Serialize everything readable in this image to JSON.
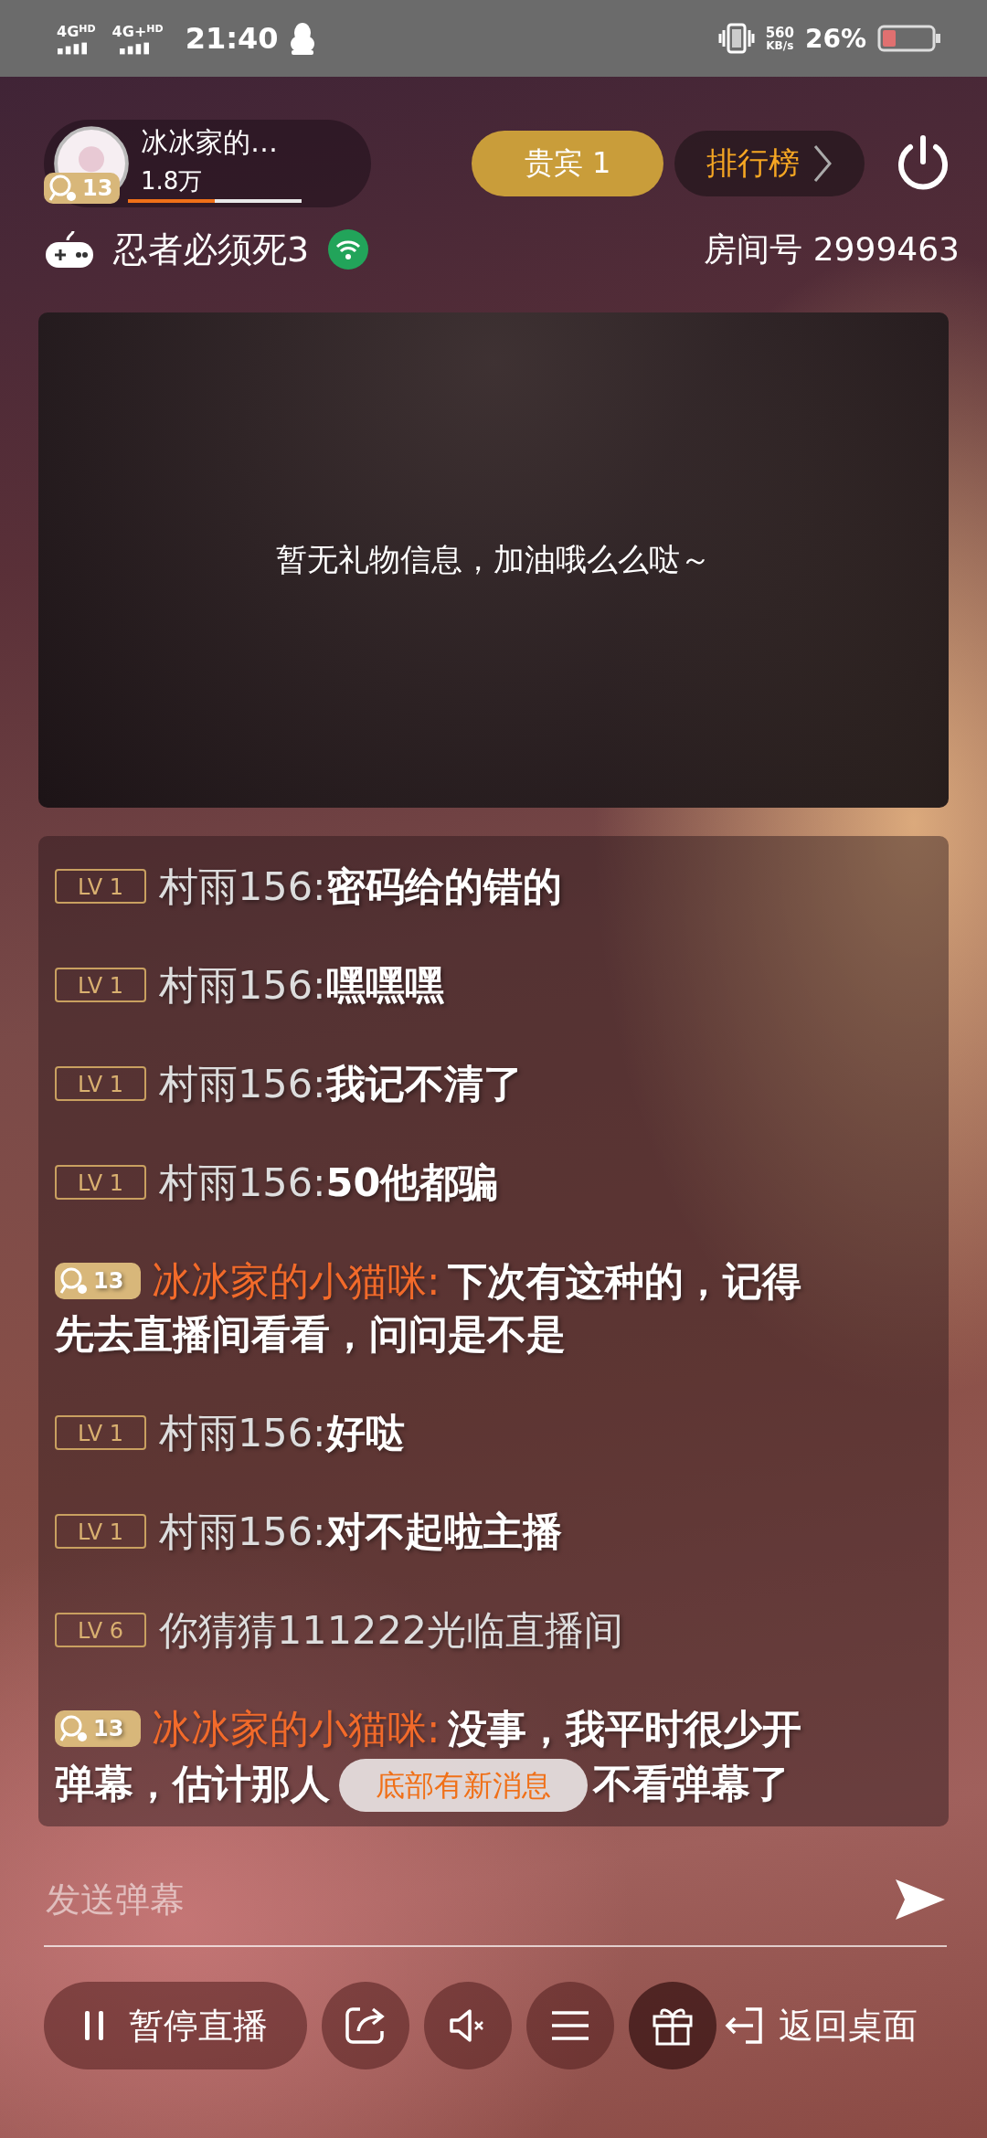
{
  "status_bar": {
    "network_1": "4G",
    "network_1_sup": "HD",
    "network_2": "4G+",
    "network_2_sup": "HD",
    "time": "21:40",
    "speed": "560",
    "speed_unit": "KB/s",
    "battery": "26%"
  },
  "anchor": {
    "name": "冰冰家的…",
    "fans": "1.8万",
    "badge": "13",
    "level": 0.5
  },
  "vip_button": "贵宾 1",
  "ranking_button": "排行榜",
  "game": {
    "title": "忍者必须死3",
    "room": "房间号 2999463"
  },
  "gift_panel": {
    "empty_text": "暂无礼物信息，加油哦么么哒～"
  },
  "messages": [
    {
      "kind": "user",
      "badge": "LV 1",
      "name": "村雨156:",
      "text": "密码给的错的"
    },
    {
      "kind": "user",
      "badge": "LV 1",
      "name": "村雨156:",
      "text": "嘿嘿嘿"
    },
    {
      "kind": "user",
      "badge": "LV 1",
      "name": "村雨156:",
      "text": "我记不清了"
    },
    {
      "kind": "user",
      "badge": "LV 1",
      "name": "村雨156:",
      "text": "50他都骗"
    },
    {
      "kind": "anchor",
      "badge": "13",
      "name": "冰冰家的小猫咪:",
      "text": "下次有这种的，记得",
      "continuation": "先去直播间看看，问问是不是"
    },
    {
      "kind": "user",
      "badge": "LV 1",
      "name": "村雨156:",
      "text": "好哒"
    },
    {
      "kind": "user",
      "badge": "LV 1",
      "name": "村雨156:",
      "text": "对不起啦主播"
    },
    {
      "kind": "system",
      "badge": "LV 6",
      "name": "你猜猜111222",
      "text": "光临直播间"
    },
    {
      "kind": "anchor",
      "badge": "13",
      "name": "冰冰家的小猫咪:",
      "text": "没事，我平时很少开",
      "continuation": "弹幕，估计那人",
      "continuation_tail": "不看弹幕了"
    }
  ],
  "toast": "底部有新消息",
  "input": {
    "placeholder": "发送弹幕"
  },
  "bottom_bar": {
    "pause_button": "暂停直播",
    "return_button": "返回桌面"
  }
}
